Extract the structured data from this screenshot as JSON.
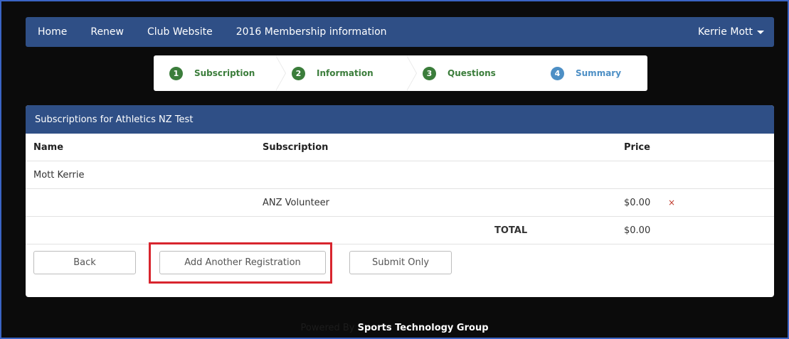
{
  "nav": {
    "items": [
      "Home",
      "Renew",
      "Club Website",
      "2016 Membership information"
    ],
    "user": "Kerrie Mott"
  },
  "wizard": {
    "steps": [
      {
        "num": "1",
        "label": "Subscription",
        "state": "done"
      },
      {
        "num": "2",
        "label": "Information",
        "state": "done"
      },
      {
        "num": "3",
        "label": "Questions",
        "state": "done"
      },
      {
        "num": "4",
        "label": "Summary",
        "state": "active"
      }
    ],
    "colors": {
      "done": "#3b7d3b",
      "active": "#4d8fc5"
    }
  },
  "panel": {
    "title": "Subscriptions for Athletics NZ Test",
    "columns": {
      "name": "Name",
      "subscription": "Subscription",
      "price": "Price"
    },
    "member": "Mott Kerrie",
    "line": {
      "subscription": "ANZ Volunteer",
      "price": "$0.00",
      "remove_icon": "×"
    },
    "total_label": "TOTAL",
    "total_value": "$0.00"
  },
  "buttons": {
    "back": "Back",
    "add_another": "Add Another Registration",
    "submit_only": "Submit Only"
  },
  "footer": {
    "prefix": "Powered By",
    "brand": "Sports Technology Group"
  },
  "theme": {
    "navy": "#2f4f86",
    "highlight": "#d8252e"
  }
}
